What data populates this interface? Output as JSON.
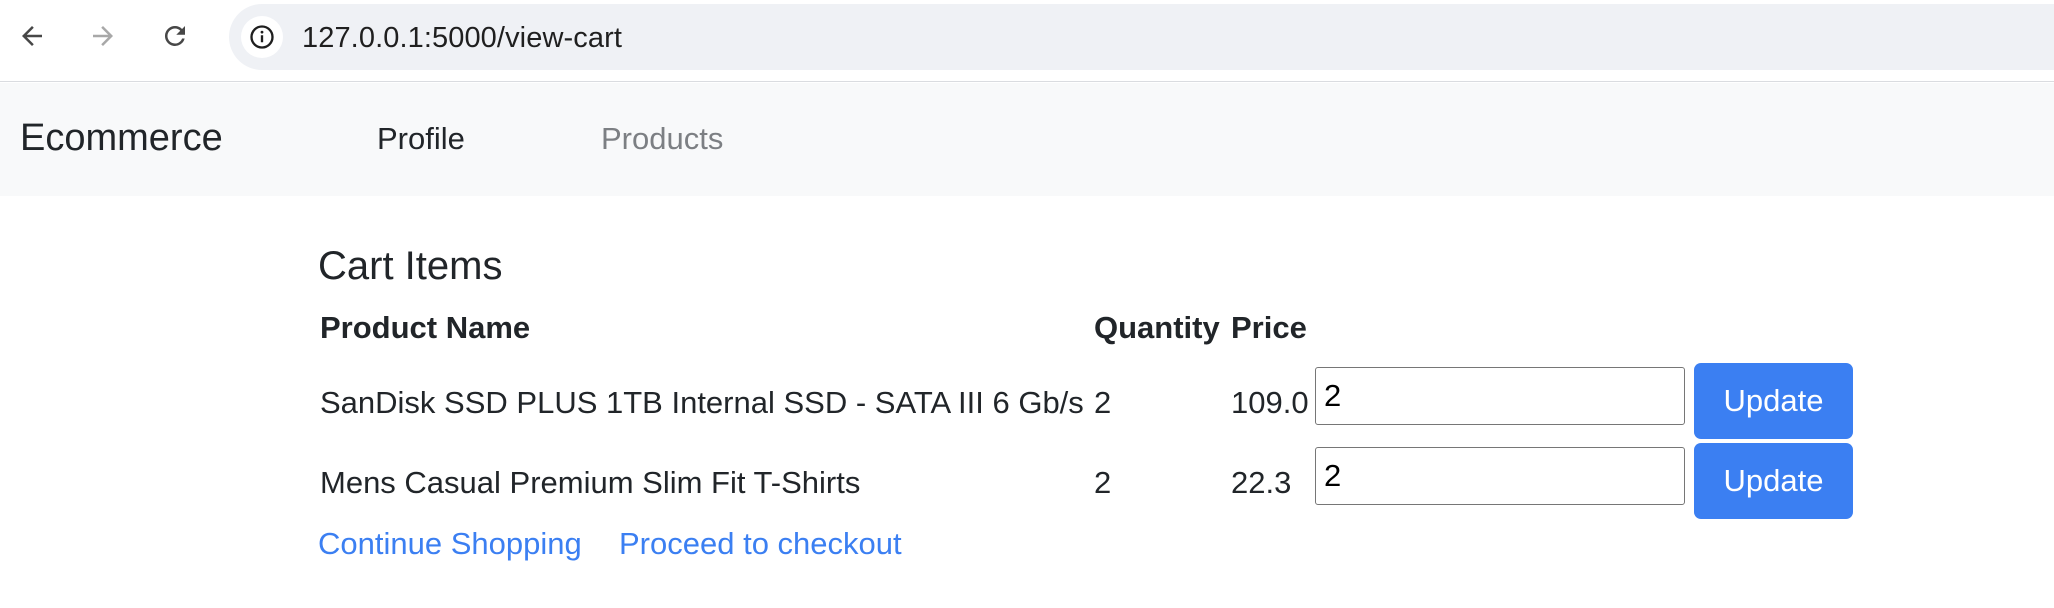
{
  "browser": {
    "url": "127.0.0.1:5000/view-cart",
    "back_icon": "arrow-left-icon",
    "forward_icon": "arrow-right-icon",
    "reload_icon": "reload-icon",
    "site_info_icon": "info-icon"
  },
  "navbar": {
    "brand": "Ecommerce",
    "links": [
      {
        "label": "Profile"
      },
      {
        "label": "Products"
      }
    ]
  },
  "main": {
    "title": "Cart Items",
    "table": {
      "columns": [
        "Product Name",
        "Quantity",
        "Price"
      ],
      "rows": [
        {
          "name": "SanDisk SSD PLUS 1TB Internal SSD - SATA III 6 Gb/s",
          "quantity": "2",
          "price": "109.0",
          "input_value": "2",
          "button": "Update"
        },
        {
          "name": "Mens Casual Premium Slim Fit T-Shirts",
          "quantity": "2",
          "price": "22.3",
          "input_value": "2",
          "button": "Update"
        }
      ]
    },
    "links": {
      "continue": "Continue Shopping",
      "checkout": "Proceed to checkout"
    }
  },
  "colors": {
    "accent": "#3b7ff2",
    "navbar_bg": "#f8f9fa",
    "muted_link": "#7c7f83"
  }
}
